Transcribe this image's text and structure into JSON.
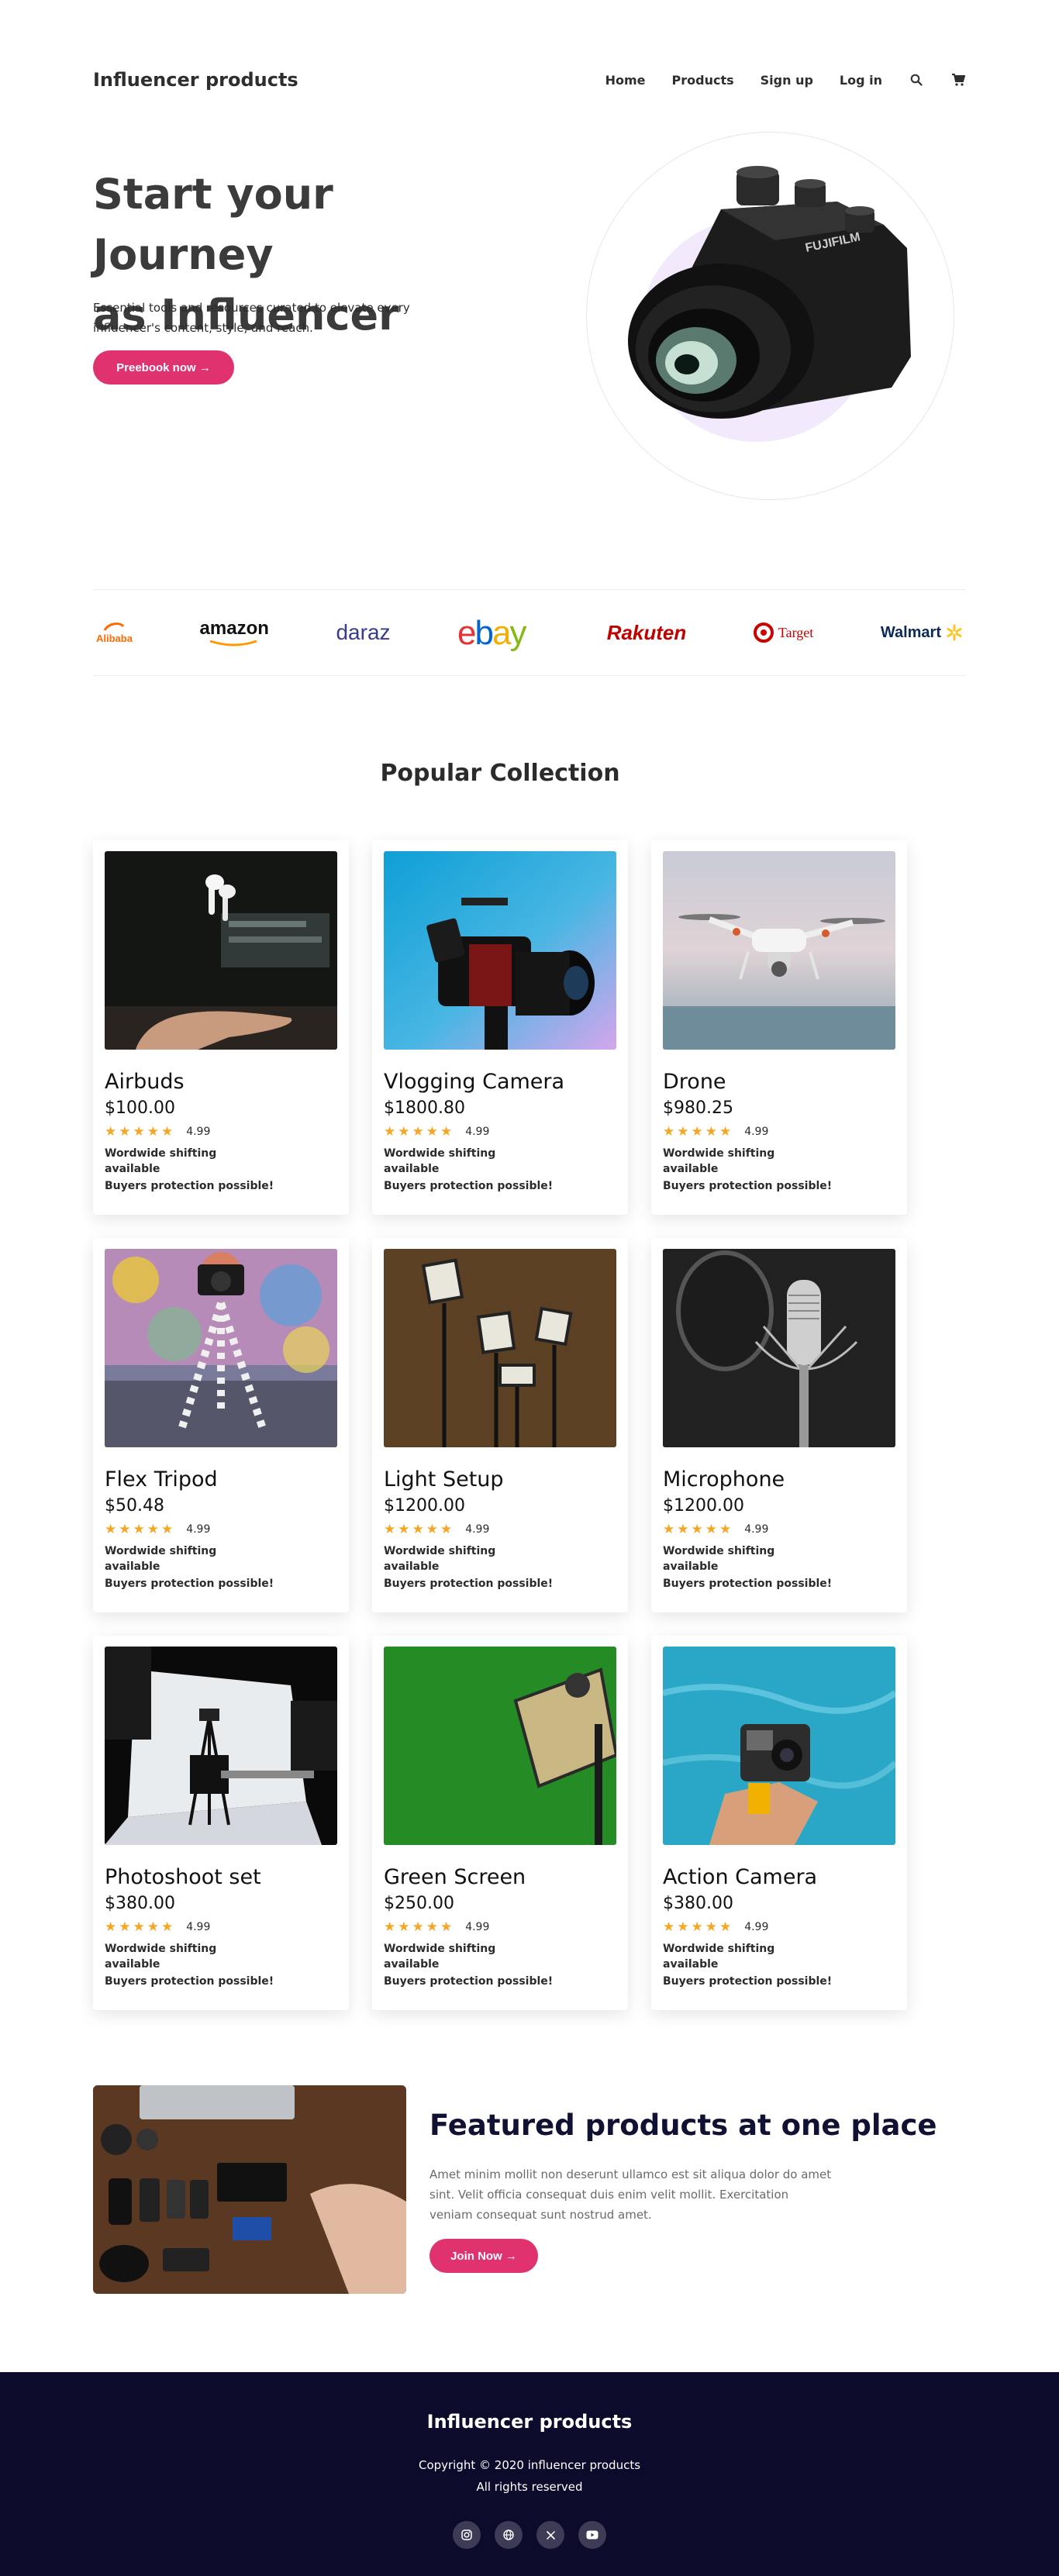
{
  "header": {
    "brand": "Influencer products",
    "nav": [
      "Home",
      "Products",
      "Sign up",
      "Log in"
    ],
    "icons": [
      "search-icon",
      "cart-icon"
    ]
  },
  "hero": {
    "title_line1": "Start your Journey",
    "title_line2": "as Influencer",
    "subtitle": "Essential tools and resources curated to elevate every influencer's content, style, and reach.",
    "cta": "Preebook now →"
  },
  "brands": [
    "Alibaba",
    "amazon",
    "daraz",
    "ebay",
    "Rakuten",
    "Target",
    "Walmart"
  ],
  "collection": {
    "title": "Popular Collection",
    "products": [
      {
        "name": "Airbuds",
        "price": "$100.00",
        "rating": "4.99",
        "shipping": "Wordwide shifting available",
        "protection": "Buyers protection possible!"
      },
      {
        "name": "Vlogging Camera",
        "price": "$1800.80",
        "rating": "4.99",
        "shipping": "Wordwide shifting available",
        "protection": "Buyers protection possible!"
      },
      {
        "name": "Drone",
        "price": "$980.25",
        "rating": "4.99",
        "shipping": "Wordwide shifting available",
        "protection": "Buyers protection possible!"
      },
      {
        "name": "Flex Tripod",
        "price": "$50.48",
        "rating": "4.99",
        "shipping": "Wordwide shifting available",
        "protection": "Buyers protection possible!"
      },
      {
        "name": "Light Setup",
        "price": "$1200.00",
        "rating": "4.99",
        "shipping": "Wordwide shifting available",
        "protection": "Buyers protection possible!"
      },
      {
        "name": "Microphone",
        "price": "$1200.00",
        "rating": "4.99",
        "shipping": "Wordwide shifting available",
        "protection": "Buyers protection possible!"
      },
      {
        "name": "Photoshoot set",
        "price": "$380.00",
        "rating": "4.99",
        "shipping": "Wordwide shifting available",
        "protection": "Buyers protection possible!"
      },
      {
        "name": "Green Screen",
        "price": "$250.00",
        "rating": "4.99",
        "shipping": "Wordwide shifting available",
        "protection": "Buyers protection possible!"
      },
      {
        "name": "Action Camera",
        "price": "$380.00",
        "rating": "4.99",
        "shipping": "Wordwide shifting available",
        "protection": "Buyers protection possible!"
      }
    ]
  },
  "featured": {
    "title": "Featured products at one place",
    "text": "Amet minim mollit non deserunt ullamco est sit aliqua dolor do amet sint. Velit officia consequat duis enim velit mollit. Exercitation veniam consequat sunt nostrud amet.",
    "cta": "Join Now →"
  },
  "footer": {
    "brand": "Influencer products",
    "copyright": "Copyright © 2020 influencer products",
    "rights": "All rights reserved",
    "socials": [
      "instagram-icon",
      "globe-icon",
      "x-icon",
      "youtube-icon"
    ]
  },
  "colors": {
    "accent": "#e0326e",
    "footer_bg": "#0d0b2c",
    "star": "#f5a623",
    "hero_blob": "#f2eafc"
  }
}
